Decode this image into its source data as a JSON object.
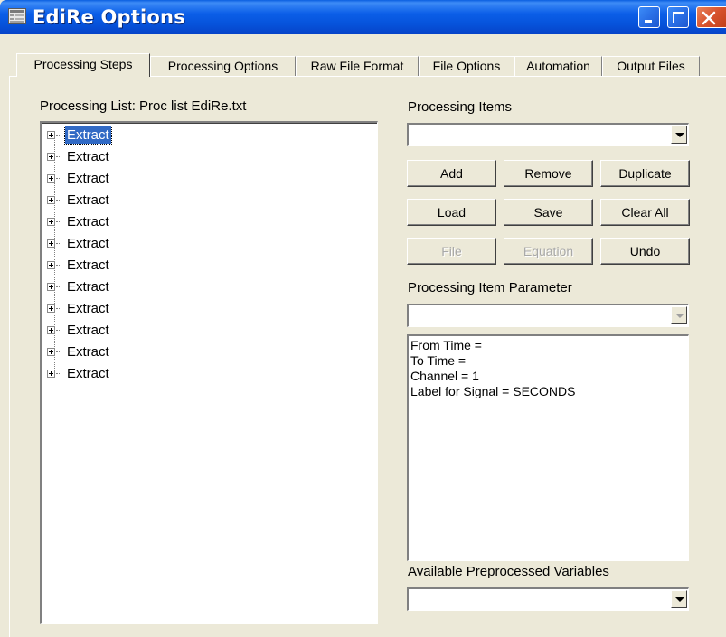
{
  "window": {
    "title": "EdiRe Options"
  },
  "tabs": [
    {
      "label": "Processing Steps",
      "active": true
    },
    {
      "label": "Processing Options",
      "active": false
    },
    {
      "label": "Raw File Format",
      "active": false
    },
    {
      "label": "File Options",
      "active": false
    },
    {
      "label": "Automation",
      "active": false
    },
    {
      "label": "Output Files",
      "active": false
    }
  ],
  "processing_list": {
    "label": "Processing List: Proc list EdiRe.txt",
    "items": [
      {
        "label": "Extract",
        "selected": true
      },
      {
        "label": "Extract",
        "selected": false
      },
      {
        "label": "Extract",
        "selected": false
      },
      {
        "label": "Extract",
        "selected": false
      },
      {
        "label": "Extract",
        "selected": false
      },
      {
        "label": "Extract",
        "selected": false
      },
      {
        "label": "Extract",
        "selected": false
      },
      {
        "label": "Extract",
        "selected": false
      },
      {
        "label": "Extract",
        "selected": false
      },
      {
        "label": "Extract",
        "selected": false
      },
      {
        "label": "Extract",
        "selected": false
      },
      {
        "label": "Extract",
        "selected": false
      }
    ]
  },
  "processing_items": {
    "label": "Processing Items",
    "value": ""
  },
  "buttons": {
    "add": "Add",
    "remove": "Remove",
    "duplicate": "Duplicate",
    "load": "Load",
    "save": "Save",
    "clear_all": "Clear All",
    "file": "File",
    "equation": "Equation",
    "undo": "Undo"
  },
  "processing_item_parameter": {
    "label": "Processing Item Parameter",
    "value": "",
    "lines": [
      "From Time =",
      "To Time =",
      "Channel = 1",
      "Label for Signal = SECONDS"
    ]
  },
  "available_preprocessed_variables": {
    "label": "Available Preprocessed Variables",
    "value": ""
  }
}
